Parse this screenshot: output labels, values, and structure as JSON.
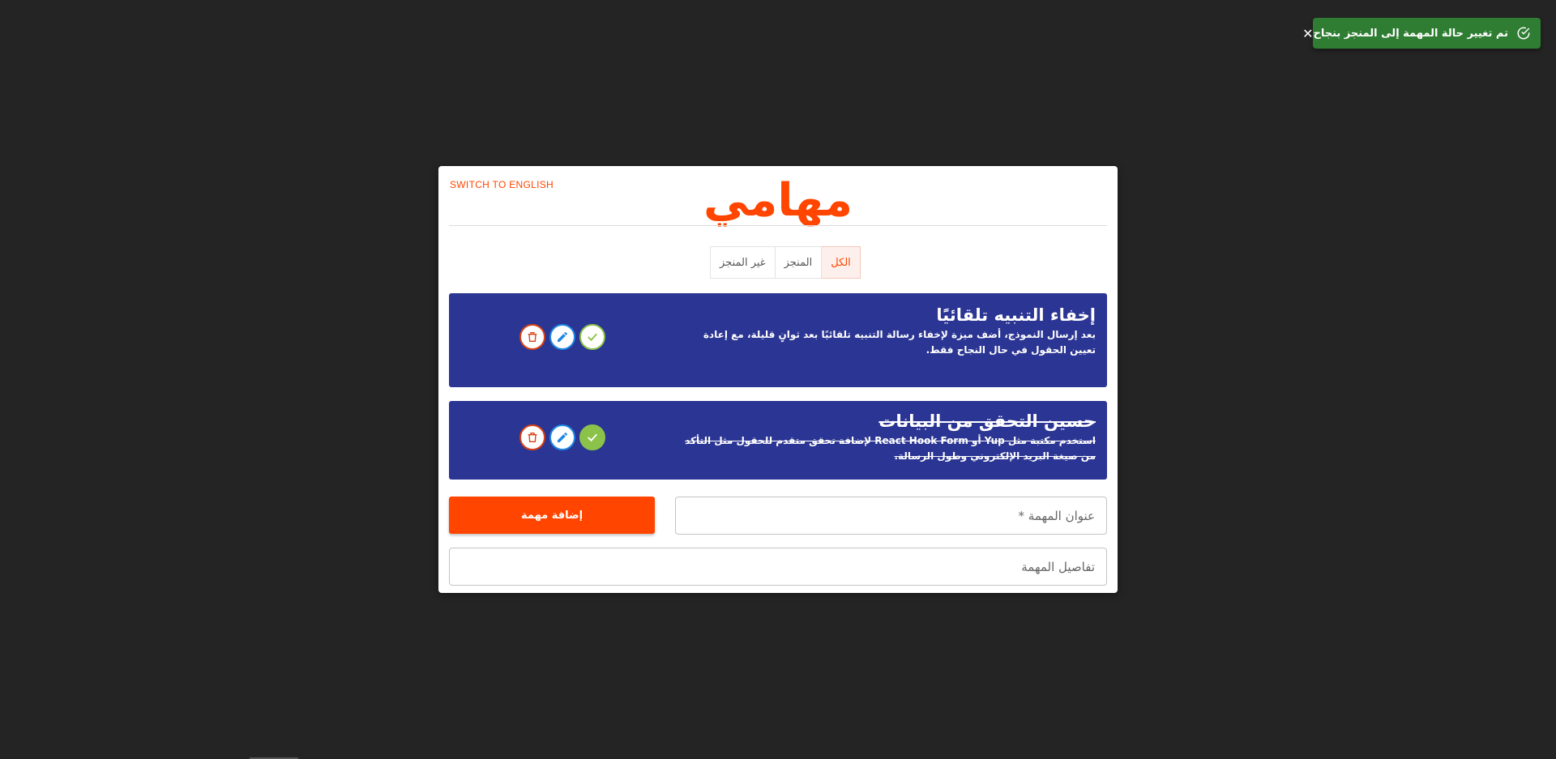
{
  "toast": {
    "message": "تم تغيير حالة المهمة إلى المنجز بنجاح",
    "close": "✕"
  },
  "header": {
    "switch_language": "SWITCH TO ENGLISH",
    "title": "مهامي"
  },
  "filters": [
    {
      "label": "الكل",
      "active": true
    },
    {
      "label": "المنجز",
      "active": false
    },
    {
      "label": "غير المنجز",
      "active": false
    }
  ],
  "tasks": [
    {
      "title": "إخفاء التنبيه تلقائيًا",
      "description": "بعد إرسال النموذج، أضف ميزة لإخفاء رسالة التنبيه تلقائيًا بعد ثوانٍ قليلة، مع إعادة تعيين الحقول في حال النجاح فقط.",
      "completed": false
    },
    {
      "title": "حسين التحقق من البيانات",
      "description": "استخدم مكتبة مثل Yup أو React Hook Form لإضافة تحقق متقدم للحقول مثل التأكد من صيغة البريد الإلكتروني وطول الرسالة.",
      "completed": true
    }
  ],
  "form": {
    "add_button": "إضافة مهمة",
    "title_placeholder": "عنوان المهمة *",
    "details_placeholder": "تفاصيل المهمة"
  },
  "colors": {
    "accent": "#ff4500",
    "task_bg": "#2b3593",
    "toast_bg": "#2e7d32",
    "complete_green": "#8bc34a",
    "delete_red": "#d84315",
    "edit_blue": "#1e88e5"
  },
  "icons": {
    "delete": "trash-icon",
    "edit": "pencil-icon",
    "complete": "check-icon",
    "toast_status": "check-circle-icon"
  }
}
